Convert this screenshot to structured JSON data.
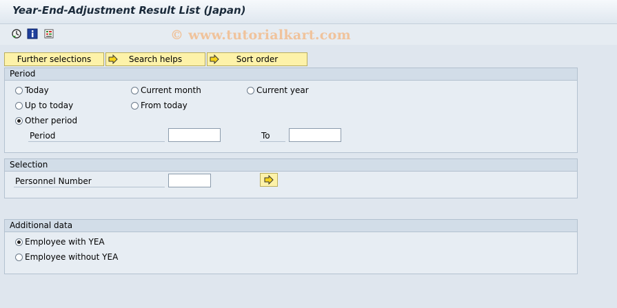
{
  "window": {
    "title": "Year-End-Adjustment Result List (Japan)"
  },
  "toolbar": {
    "icons": [
      "execute-icon",
      "info-icon",
      "selection-options-icon"
    ],
    "watermark": "© www.tutorialkart.com"
  },
  "tabs": {
    "further_selections": "Further selections",
    "search_helps": "Search helps",
    "sort_order": "Sort order"
  },
  "period_group": {
    "header": "Period",
    "radios": {
      "today": {
        "label": "Today",
        "selected": false
      },
      "current_month": {
        "label": "Current month",
        "selected": false
      },
      "current_year": {
        "label": "Current year",
        "selected": false
      },
      "up_to_today": {
        "label": "Up to today",
        "selected": false
      },
      "from_today": {
        "label": "From today",
        "selected": false
      },
      "other_period": {
        "label": "Other period",
        "selected": true
      }
    },
    "period_label": "Period",
    "to_label": "To",
    "period_from_value": "",
    "period_to_value": ""
  },
  "selection_group": {
    "header": "Selection",
    "personnel_label": "Personnel Number",
    "personnel_value": ""
  },
  "additional_group": {
    "header": "Additional data",
    "radios": {
      "with_yea": {
        "label": "Employee with YEA",
        "selected": true
      },
      "without_yea": {
        "label": "Employee without YEA",
        "selected": false
      }
    }
  },
  "colors": {
    "button_yellow": "#fdf2a9",
    "arrow_yellow": "#f5d21b",
    "group_header": "#d2dde8",
    "background": "#dfe6ee"
  }
}
